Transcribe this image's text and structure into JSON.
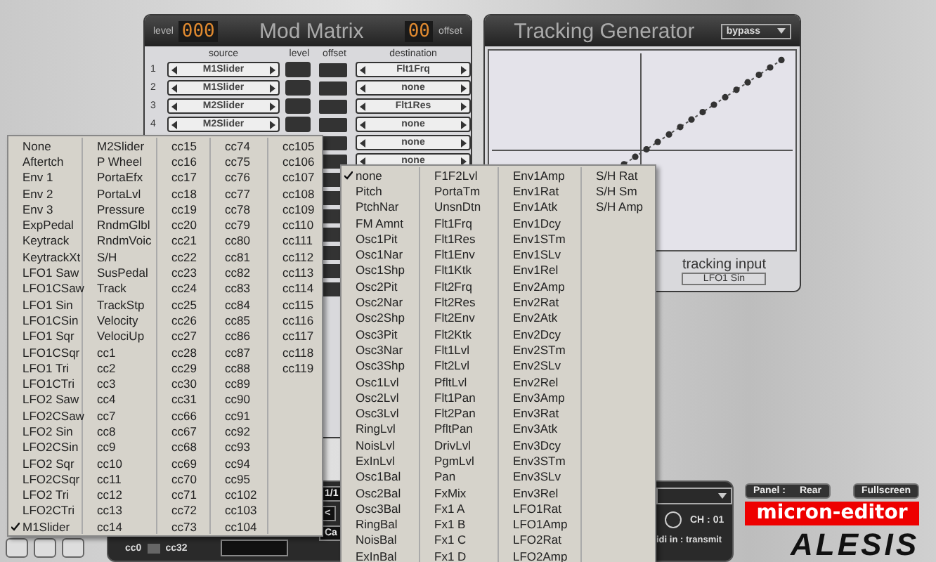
{
  "mod_matrix": {
    "title": "Mod Matrix",
    "level_label": "level",
    "level_display": "000",
    "offset_display": "00",
    "offset_label": "offset",
    "columns": [
      "source",
      "level",
      "offset",
      "destination"
    ],
    "rows": [
      {
        "number": "1",
        "source": "M1Slider",
        "destination": "Flt1Frq"
      },
      {
        "number": "2",
        "source": "M1Slider",
        "destination": "none"
      },
      {
        "number": "3",
        "source": "M2Slider",
        "destination": "Flt1Res"
      },
      {
        "number": "4",
        "source": "M2Slider",
        "destination": "none"
      }
    ],
    "partial_rows": [
      {
        "destination": "none"
      },
      {
        "destination": "none"
      }
    ]
  },
  "tracking_generator": {
    "title": "Tracking Generator",
    "mode": "bypass",
    "input_label": "tracking input",
    "input": "LFO1 Sin"
  },
  "source_menu": {
    "columns": [
      [
        {
          "label": "None",
          "checked": false
        },
        {
          "label": "Aftertch",
          "checked": false
        },
        {
          "label": "Env 1",
          "checked": false
        },
        {
          "label": "Env 2",
          "checked": false
        },
        {
          "label": "Env 3",
          "checked": false
        },
        {
          "label": "ExpPedal",
          "checked": false
        },
        {
          "label": "Keytrack",
          "checked": false
        },
        {
          "label": "KeytrackXt",
          "checked": false
        },
        {
          "label": "LFO1 Saw",
          "checked": false
        },
        {
          "label": "LFO1CSaw",
          "checked": false
        },
        {
          "label": "LFO1 Sin",
          "checked": false
        },
        {
          "label": "LFO1CSin",
          "checked": false
        },
        {
          "label": "LFO1 Sqr",
          "checked": false
        },
        {
          "label": "LFO1CSqr",
          "checked": false
        },
        {
          "label": "LFO1 Tri",
          "checked": false
        },
        {
          "label": "LFO1CTri",
          "checked": false
        },
        {
          "label": "LFO2 Saw",
          "checked": false
        },
        {
          "label": "LFO2CSaw",
          "checked": false
        },
        {
          "label": "LFO2 Sin",
          "checked": false
        },
        {
          "label": "LFO2CSin",
          "checked": false
        },
        {
          "label": "LFO2 Sqr",
          "checked": false
        },
        {
          "label": "LFO2CSqr",
          "checked": false
        },
        {
          "label": "LFO2 Tri",
          "checked": false
        },
        {
          "label": "LFO2CTri",
          "checked": false
        },
        {
          "label": "M1Slider",
          "checked": true
        }
      ],
      [
        {
          "label": "M2Slider",
          "checked": false
        },
        {
          "label": "P Wheel",
          "checked": false
        },
        {
          "label": "PortaEfx",
          "checked": false
        },
        {
          "label": "PortaLvl",
          "checked": false
        },
        {
          "label": "Pressure",
          "checked": false
        },
        {
          "label": "RndmGlbl",
          "checked": false
        },
        {
          "label": "RndmVoic",
          "checked": false
        },
        {
          "label": "S/H",
          "checked": false
        },
        {
          "label": "SusPedal",
          "checked": false
        },
        {
          "label": "Track",
          "checked": false
        },
        {
          "label": "TrackStp",
          "checked": false
        },
        {
          "label": "Velocity",
          "checked": false
        },
        {
          "label": "VelociUp",
          "checked": false
        },
        {
          "label": "cc1",
          "checked": false
        },
        {
          "label": "cc2",
          "checked": false
        },
        {
          "label": "cc3",
          "checked": false
        },
        {
          "label": "cc4",
          "checked": false
        },
        {
          "label": "cc7",
          "checked": false
        },
        {
          "label": "cc8",
          "checked": false
        },
        {
          "label": "cc9",
          "checked": false
        },
        {
          "label": "cc10",
          "checked": false
        },
        {
          "label": "cc11",
          "checked": false
        },
        {
          "label": "cc12",
          "checked": false
        },
        {
          "label": "cc13",
          "checked": false
        },
        {
          "label": "cc14",
          "checked": false
        }
      ],
      [
        {
          "label": "cc15",
          "checked": false
        },
        {
          "label": "cc16",
          "checked": false
        },
        {
          "label": "cc17",
          "checked": false
        },
        {
          "label": "cc18",
          "checked": false
        },
        {
          "label": "cc19",
          "checked": false
        },
        {
          "label": "cc20",
          "checked": false
        },
        {
          "label": "cc21",
          "checked": false
        },
        {
          "label": "cc22",
          "checked": false
        },
        {
          "label": "cc23",
          "checked": false
        },
        {
          "label": "cc24",
          "checked": false
        },
        {
          "label": "cc25",
          "checked": false
        },
        {
          "label": "cc26",
          "checked": false
        },
        {
          "label": "cc27",
          "checked": false
        },
        {
          "label": "cc28",
          "checked": false
        },
        {
          "label": "cc29",
          "checked": false
        },
        {
          "label": "cc30",
          "checked": false
        },
        {
          "label": "cc31",
          "checked": false
        },
        {
          "label": "cc66",
          "checked": false
        },
        {
          "label": "cc67",
          "checked": false
        },
        {
          "label": "cc68",
          "checked": false
        },
        {
          "label": "cc69",
          "checked": false
        },
        {
          "label": "cc70",
          "checked": false
        },
        {
          "label": "cc71",
          "checked": false
        },
        {
          "label": "cc72",
          "checked": false
        },
        {
          "label": "cc73",
          "checked": false
        }
      ],
      [
        {
          "label": "cc74",
          "checked": false
        },
        {
          "label": "cc75",
          "checked": false
        },
        {
          "label": "cc76",
          "checked": false
        },
        {
          "label": "cc77",
          "checked": false
        },
        {
          "label": "cc78",
          "checked": false
        },
        {
          "label": "cc79",
          "checked": false
        },
        {
          "label": "cc80",
          "checked": false
        },
        {
          "label": "cc81",
          "checked": false
        },
        {
          "label": "cc82",
          "checked": false
        },
        {
          "label": "cc83",
          "checked": false
        },
        {
          "label": "cc84",
          "checked": false
        },
        {
          "label": "cc85",
          "checked": false
        },
        {
          "label": "cc86",
          "checked": false
        },
        {
          "label": "cc87",
          "checked": false
        },
        {
          "label": "cc88",
          "checked": false
        },
        {
          "label": "cc89",
          "checked": false
        },
        {
          "label": "cc90",
          "checked": false
        },
        {
          "label": "cc91",
          "checked": false
        },
        {
          "label": "cc92",
          "checked": false
        },
        {
          "label": "cc93",
          "checked": false
        },
        {
          "label": "cc94",
          "checked": false
        },
        {
          "label": "cc95",
          "checked": false
        },
        {
          "label": "cc102",
          "checked": false
        },
        {
          "label": "cc103",
          "checked": false
        },
        {
          "label": "cc104",
          "checked": false
        }
      ],
      [
        {
          "label": "cc105",
          "checked": false
        },
        {
          "label": "cc106",
          "checked": false
        },
        {
          "label": "cc107",
          "checked": false
        },
        {
          "label": "cc108",
          "checked": false
        },
        {
          "label": "cc109",
          "checked": false
        },
        {
          "label": "cc110",
          "checked": false
        },
        {
          "label": "cc111",
          "checked": false
        },
        {
          "label": "cc112",
          "checked": false
        },
        {
          "label": "cc113",
          "checked": false
        },
        {
          "label": "cc114",
          "checked": false
        },
        {
          "label": "cc115",
          "checked": false
        },
        {
          "label": "cc116",
          "checked": false
        },
        {
          "label": "cc117",
          "checked": false
        },
        {
          "label": "cc118",
          "checked": false
        },
        {
          "label": "cc119",
          "checked": false
        }
      ]
    ]
  },
  "destination_menu": {
    "columns": [
      [
        {
          "label": "none",
          "checked": true
        },
        {
          "label": "Pitch",
          "checked": false
        },
        {
          "label": "PtchNar",
          "checked": false
        },
        {
          "label": "FM Amnt",
          "checked": false
        },
        {
          "label": "Osc1Pit",
          "checked": false
        },
        {
          "label": "Osc1Nar",
          "checked": false
        },
        {
          "label": "Osc1Shp",
          "checked": false
        },
        {
          "label": "Osc2Pit",
          "checked": false
        },
        {
          "label": "Osc2Nar",
          "checked": false
        },
        {
          "label": "Osc2Shp",
          "checked": false
        },
        {
          "label": "Osc3Pit",
          "checked": false
        },
        {
          "label": "Osc3Nar",
          "checked": false
        },
        {
          "label": "Osc3Shp",
          "checked": false
        },
        {
          "label": "Osc1Lvl",
          "checked": false
        },
        {
          "label": "Osc2Lvl",
          "checked": false
        },
        {
          "label": "Osc3Lvl",
          "checked": false
        },
        {
          "label": "RingLvl",
          "checked": false
        },
        {
          "label": "NoisLvl",
          "checked": false
        },
        {
          "label": "ExInLvl",
          "checked": false
        },
        {
          "label": "Osc1Bal",
          "checked": false
        },
        {
          "label": "Osc2Bal",
          "checked": false
        },
        {
          "label": "Osc3Bal",
          "checked": false
        },
        {
          "label": "RingBal",
          "checked": false
        },
        {
          "label": "NoisBal",
          "checked": false
        },
        {
          "label": "ExInBal",
          "checked": false
        }
      ],
      [
        {
          "label": "F1F2Lvl",
          "checked": false
        },
        {
          "label": "PortaTm",
          "checked": false
        },
        {
          "label": "UnsnDtn",
          "checked": false
        },
        {
          "label": "Flt1Frq",
          "checked": false
        },
        {
          "label": "Flt1Res",
          "checked": false
        },
        {
          "label": "Flt1Env",
          "checked": false
        },
        {
          "label": "Flt1Ktk",
          "checked": false
        },
        {
          "label": "Flt2Frq",
          "checked": false
        },
        {
          "label": "Flt2Res",
          "checked": false
        },
        {
          "label": "Flt2Env",
          "checked": false
        },
        {
          "label": "Flt2Ktk",
          "checked": false
        },
        {
          "label": "Flt1Lvl",
          "checked": false
        },
        {
          "label": "Flt2Lvl",
          "checked": false
        },
        {
          "label": "PfltLvl",
          "checked": false
        },
        {
          "label": "Flt1Pan",
          "checked": false
        },
        {
          "label": "Flt2Pan",
          "checked": false
        },
        {
          "label": "PfltPan",
          "checked": false
        },
        {
          "label": "DrivLvl",
          "checked": false
        },
        {
          "label": "PgmLvl",
          "checked": false
        },
        {
          "label": "Pan",
          "checked": false
        },
        {
          "label": "FxMix",
          "checked": false
        },
        {
          "label": "Fx1 A",
          "checked": false
        },
        {
          "label": "Fx1 B",
          "checked": false
        },
        {
          "label": "Fx1 C",
          "checked": false
        },
        {
          "label": "Fx1 D",
          "checked": false
        }
      ],
      [
        {
          "label": "Env1Amp",
          "checked": false
        },
        {
          "label": "Env1Rat",
          "checked": false
        },
        {
          "label": "Env1Atk",
          "checked": false
        },
        {
          "label": "Env1Dcy",
          "checked": false
        },
        {
          "label": "Env1STm",
          "checked": false
        },
        {
          "label": "Env1SLv",
          "checked": false
        },
        {
          "label": "Env1Rel",
          "checked": false
        },
        {
          "label": "Env2Amp",
          "checked": false
        },
        {
          "label": "Env2Rat",
          "checked": false
        },
        {
          "label": "Env2Atk",
          "checked": false
        },
        {
          "label": "Env2Dcy",
          "checked": false
        },
        {
          "label": "Env2STm",
          "checked": false
        },
        {
          "label": "Env2SLv",
          "checked": false
        },
        {
          "label": "Env2Rel",
          "checked": false
        },
        {
          "label": "Env3Amp",
          "checked": false
        },
        {
          "label": "Env3Rat",
          "checked": false
        },
        {
          "label": "Env3Atk",
          "checked": false
        },
        {
          "label": "Env3Dcy",
          "checked": false
        },
        {
          "label": "Env3STm",
          "checked": false
        },
        {
          "label": "Env3SLv",
          "checked": false
        },
        {
          "label": "Env3Rel",
          "checked": false
        },
        {
          "label": "LFO1Rat",
          "checked": false
        },
        {
          "label": "LFO1Amp",
          "checked": false
        },
        {
          "label": "LFO2Rat",
          "checked": false
        },
        {
          "label": "LFO2Amp",
          "checked": false
        }
      ],
      [
        {
          "label": "S/H Rat",
          "checked": false
        },
        {
          "label": "S/H Sm",
          "checked": false
        },
        {
          "label": "S/H Amp",
          "checked": false
        }
      ]
    ]
  },
  "bottom_panel": {
    "page": "1/1",
    "prev": "<",
    "cancel": "Ca",
    "cc_left": "cc0",
    "cc_right": "cc32",
    "channel": "CH : 01",
    "midi_in": "idi in : transmit"
  },
  "panel_button": {
    "label": "Panel :",
    "value": "Rear"
  },
  "fullscreen_button": "Fullscreen",
  "logo": "micron-editor",
  "brand": "ALESIS"
}
